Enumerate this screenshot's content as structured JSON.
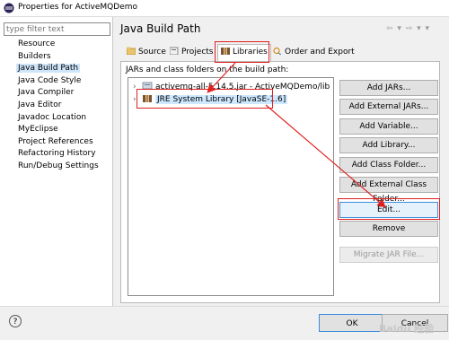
{
  "window": {
    "title": "Properties for ActiveMQDemo"
  },
  "filter": {
    "placeholder": "type filter text"
  },
  "tree": [
    {
      "label": "Resource",
      "selected": false
    },
    {
      "label": "Builders",
      "selected": false
    },
    {
      "label": "Java Build Path",
      "selected": true
    },
    {
      "label": "Java Code Style",
      "selected": false
    },
    {
      "label": "Java Compiler",
      "selected": false
    },
    {
      "label": "Java Editor",
      "selected": false
    },
    {
      "label": "Javadoc Location",
      "selected": false
    },
    {
      "label": "MyEclipse",
      "selected": false
    },
    {
      "label": "Project References",
      "selected": false
    },
    {
      "label": "Refactoring History",
      "selected": false
    },
    {
      "label": "Run/Debug Settings",
      "selected": false
    }
  ],
  "page": {
    "title": "Java Build Path",
    "nav": "⇦ ▾ ⇨ ▾ ▾",
    "body_label": "JARs and class folders on the build path:"
  },
  "tabs": [
    {
      "label": "Source",
      "icon": "source-folder-icon",
      "active": false
    },
    {
      "label": "Projects",
      "icon": "projects-icon",
      "active": false
    },
    {
      "label": "Libraries",
      "icon": "libraries-icon",
      "active": true
    },
    {
      "label": "Order and Export",
      "icon": "order-export-icon",
      "active": false
    }
  ],
  "libraries": [
    {
      "label": "activemq-all-5.14.5.jar - ActiveMQDemo/lib",
      "icon": "jar-icon",
      "expander": "›",
      "selected": false
    },
    {
      "label": "JRE System Library [JavaSE-1.6]",
      "icon": "jre-library-icon",
      "expander": "›",
      "selected": true
    }
  ],
  "buttons": {
    "add_jars": "Add JARs...",
    "add_external_jars": "Add External JARs...",
    "add_variable": "Add Variable...",
    "add_library": "Add Library...",
    "add_class_folder": "Add Class Folder...",
    "add_external_class_folder": "Add External Class Folder...",
    "edit": "Edit...",
    "remove": "Remove",
    "migrate_jar": "Migrate JAR File..."
  },
  "footer": {
    "help": "?",
    "ok": "OK",
    "cancel": "Cancel"
  },
  "watermark": "Baidu 经验",
  "colors": {
    "annotation_red": "#e02020",
    "selection_blue": "#cde8ff",
    "focus_blue": "#3c8ddb"
  }
}
